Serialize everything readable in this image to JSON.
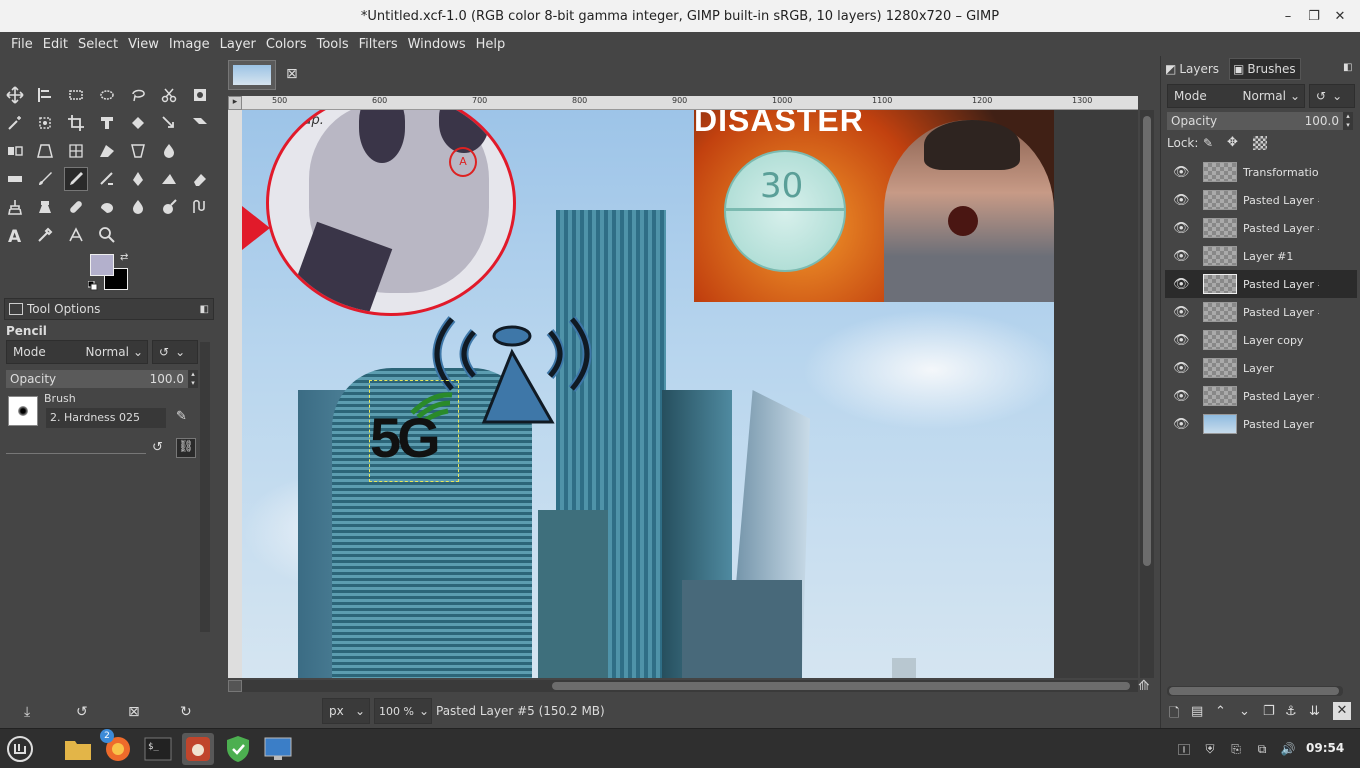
{
  "window": {
    "title": "*Untitled.xcf-1.0 (RGB color 8-bit gamma integer, GIMP built-in sRGB, 10 layers) 1280x720 – GIMP"
  },
  "menu": [
    "File",
    "Edit",
    "Select",
    "View",
    "Image",
    "Layer",
    "Colors",
    "Tools",
    "Filters",
    "Windows",
    "Help"
  ],
  "tool_options": {
    "tab_label": "Tool Options",
    "tool_name": "Pencil",
    "mode_label": "Mode",
    "mode_value": "Normal",
    "opacity_label": "Opacity",
    "opacity_value": "100.0",
    "brush_label": "Brush",
    "brush_value": "2. Hardness 025"
  },
  "canvas": {
    "ruler_marks": [
      "500",
      "600",
      "700",
      "800",
      "900",
      "1000",
      "1100",
      "1200",
      "1300"
    ],
    "image_text_disaster": "DISASTER",
    "image_text_pill": "30",
    "image_text_5g": "5G",
    "image_text_sup": "Sup."
  },
  "status": {
    "unit": "px",
    "zoom": "100 %",
    "message": "Pasted Layer #5 (150.2 MB)"
  },
  "layers_panel": {
    "tab_layers": "Layers",
    "tab_brushes": "Brushes",
    "mode_label": "Mode",
    "mode_value": "Normal",
    "opacity_label": "Opacity",
    "opacity_value": "100.0",
    "lock_label": "Lock:",
    "layers": [
      {
        "name": "Transformation"
      },
      {
        "name": "Pasted Layer #"
      },
      {
        "name": "Pasted Layer #"
      },
      {
        "name": "Layer #1"
      },
      {
        "name": "Pasted Layer #"
      },
      {
        "name": "Pasted Layer #"
      },
      {
        "name": "Layer copy"
      },
      {
        "name": "Layer"
      },
      {
        "name": "Pasted Layer #"
      },
      {
        "name": "Pasted Layer"
      }
    ],
    "selected_index": 4
  },
  "taskbar": {
    "clock": "09:54",
    "badge": "2"
  }
}
